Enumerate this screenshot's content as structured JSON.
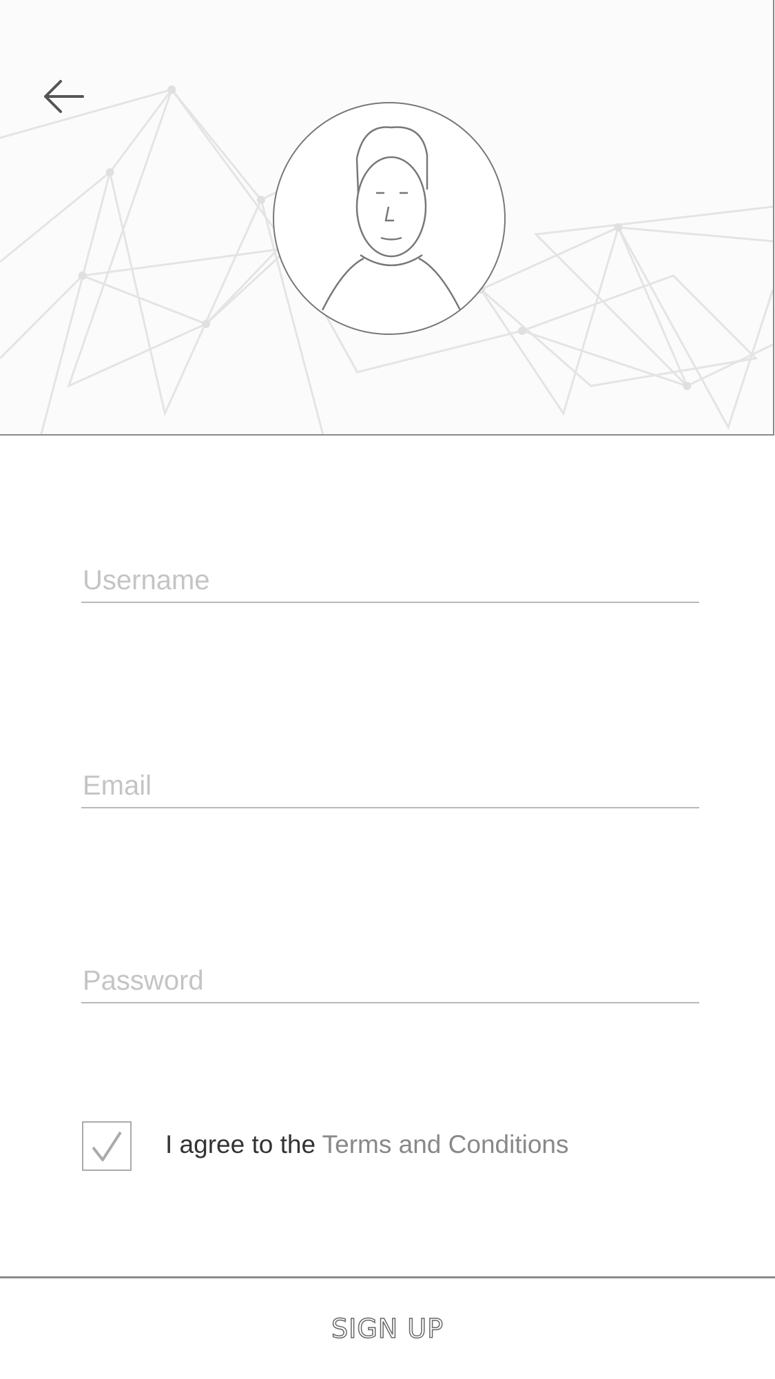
{
  "header": {
    "back_icon": "arrow-left-icon",
    "avatar_alt": "profile-photo"
  },
  "form": {
    "username": {
      "value": "",
      "placeholder": "Username"
    },
    "email": {
      "value": "",
      "placeholder": "Email"
    },
    "password": {
      "value": "",
      "placeholder": "Password"
    }
  },
  "terms": {
    "checked": true,
    "prefix": "I agree to the ",
    "link": "Terms and Conditions"
  },
  "footer": {
    "signup_label": "SIGN UP"
  }
}
